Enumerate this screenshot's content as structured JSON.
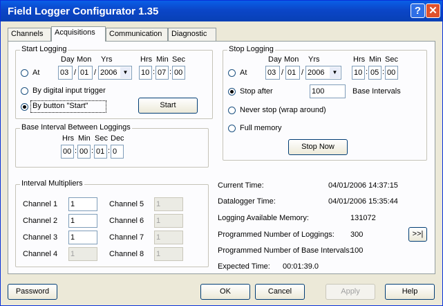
{
  "window": {
    "title": "Field Logger Configurator 1.35",
    "help_glyph": "?",
    "close_glyph": "✕"
  },
  "tabs": [
    {
      "label": "Channels"
    },
    {
      "label": "Acquisitions"
    },
    {
      "label": "Communication"
    },
    {
      "label": "Diagnostic"
    }
  ],
  "start_logging": {
    "title": "Start Logging",
    "headers": {
      "day": "Day",
      "mon": "Mon",
      "yrs": "Yrs",
      "hrs": "Hrs",
      "min": "Min",
      "sec": "Sec"
    },
    "at_label": "At",
    "day": "03",
    "mon": "01",
    "yrs": "2006",
    "hrs": "10",
    "min": "07",
    "sec": "00",
    "digital_trigger_label": "By digital input trigger",
    "button_start_label": "By button \"Start\"",
    "start_button": "Start",
    "selected": "button"
  },
  "stop_logging": {
    "title": "Stop Logging",
    "headers": {
      "day": "Day",
      "mon": "Mon",
      "yrs": "Yrs",
      "hrs": "Hrs",
      "min": "Min",
      "sec": "Sec"
    },
    "at_label": "At",
    "day": "03",
    "mon": "01",
    "yrs": "2006",
    "hrs": "10",
    "min": "05",
    "sec": "00",
    "stop_after_label": "Stop after",
    "stop_after_value": "100",
    "base_intervals_label": "Base Intervals",
    "never_stop_label": "Never stop (wrap around)",
    "full_memory_label": "Full memory",
    "stop_now_button": "Stop Now",
    "selected": "stop_after"
  },
  "base_interval": {
    "title": "Base Interval Between Loggings",
    "headers": {
      "hrs": "Hrs",
      "min": "Min",
      "sec": "Sec",
      "dec": "Dec"
    },
    "hrs": "00",
    "min": "00",
    "sec": "01",
    "dec": "0"
  },
  "interval_multipliers": {
    "title": "Interval Multipliers",
    "channels": [
      {
        "label": "Channel 1",
        "value": "1"
      },
      {
        "label": "Channel 2",
        "value": "1"
      },
      {
        "label": "Channel 3",
        "value": "1"
      },
      {
        "label": "Channel 4",
        "value": "1"
      },
      {
        "label": "Channel 5",
        "value": "1"
      },
      {
        "label": "Channel 6",
        "value": "1"
      },
      {
        "label": "Channel 7",
        "value": "1"
      },
      {
        "label": "Channel 8",
        "value": "1"
      }
    ]
  },
  "status": {
    "current_time_label": "Current Time:",
    "current_time": "04/01/2006  14:37:15",
    "datalogger_time_label": "Datalogger Time:",
    "datalogger_time": "04/01/2006  15:35:44",
    "memory_label": "Logging Available Memory:",
    "memory": "131072",
    "num_loggings_label": "Programmed Number of Loggings:",
    "num_loggings": "300",
    "num_base_label": "Programmed Number of Base Intervals:",
    "num_base": "100",
    "expected_label": "Expected Time:",
    "expected": "00:01:39.0",
    "more_button": ">>|"
  },
  "buttons": {
    "password": "Password",
    "ok": "OK",
    "cancel": "Cancel",
    "apply": "Apply",
    "help": "Help"
  }
}
